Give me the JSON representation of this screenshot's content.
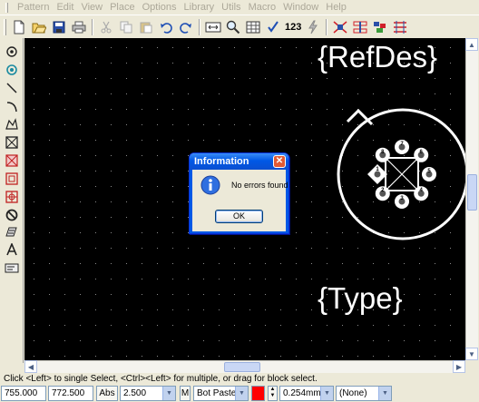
{
  "menu": [
    "Pattern",
    "Edit",
    "View",
    "Place",
    "Options",
    "Library",
    "Utils",
    "Macro",
    "Window",
    "Help"
  ],
  "toolbar": {
    "numbering_label": "123"
  },
  "canvas": {
    "refdes_text": "{RefDes}",
    "type_text": "{Type}",
    "pad_numbers": [
      "1",
      "2",
      "3",
      "4",
      "5",
      "6",
      "7",
      "8"
    ],
    "colors": {
      "background": "#000000",
      "grid_dot": "#8a8a8a",
      "outline": "#ffffff"
    }
  },
  "dialog": {
    "title": "Information",
    "message": "No errors found!",
    "ok_label": "OK",
    "icon": "info-icon"
  },
  "status": {
    "hint": "Click <Left> to single Select, <Ctrl><Left> for multiple, or drag for block select."
  },
  "bottom": {
    "x_coord": "755.000",
    "y_coord": "772.500",
    "abs_label": "Abs",
    "grid_value": "2.500",
    "m_label": "M",
    "layer": "Bot Paste",
    "layer_color": "#ff0000",
    "line_width": "0.254mm",
    "none_option": "(None)"
  }
}
